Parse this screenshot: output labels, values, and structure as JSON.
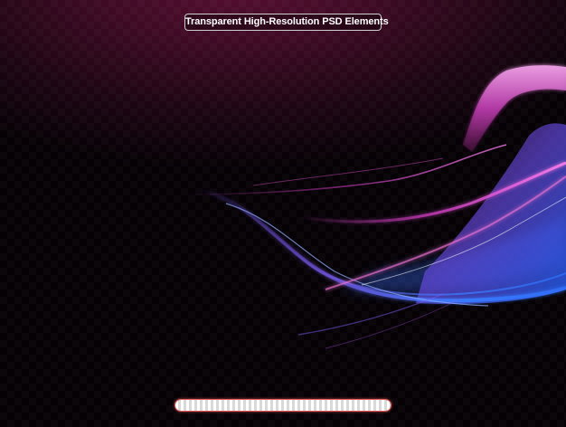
{
  "badge": {
    "label": "Transparent High-Resolution PSD Elements"
  },
  "colors": {
    "background_top": "#3d0a24",
    "background_bottom": "#000000",
    "wave_magenta": "#d63fc8",
    "wave_violet": "#8a5cf0",
    "wave_blue": "#3a7dff",
    "wave_pink": "#e870d0"
  },
  "icons": {
    "bar": "transparency-checker-bar"
  }
}
